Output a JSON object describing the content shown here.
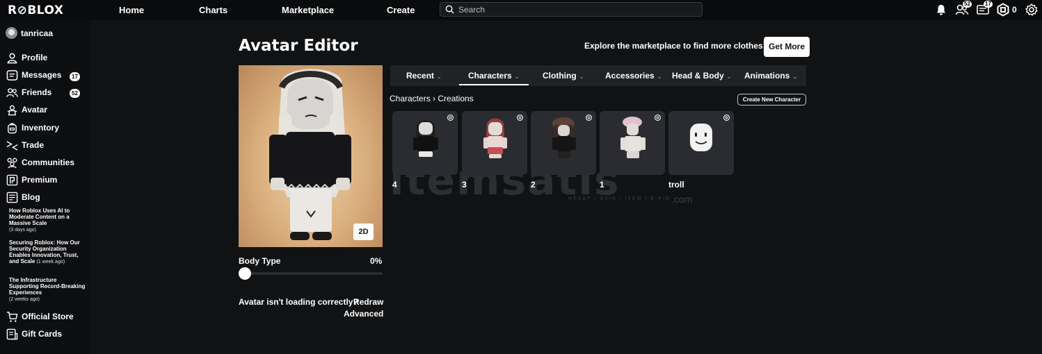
{
  "topbar": {
    "logo": "R⊘BLOX",
    "nav": [
      "Home",
      "Charts",
      "Marketplace",
      "Create"
    ],
    "search_placeholder": "Search",
    "friends_badge": "52",
    "messages_badge": "17",
    "robux": "0"
  },
  "sidebar": {
    "username": "tanricaa",
    "items": [
      {
        "label": "Profile",
        "icon": "person-icon"
      },
      {
        "label": "Messages",
        "icon": "messages-icon",
        "badge": "17"
      },
      {
        "label": "Friends",
        "icon": "friends-icon",
        "badge": "52"
      },
      {
        "label": "Avatar",
        "icon": "avatar-icon"
      },
      {
        "label": "Inventory",
        "icon": "inventory-icon"
      },
      {
        "label": "Trade",
        "icon": "trade-icon"
      },
      {
        "label": "Communities",
        "icon": "communities-icon"
      },
      {
        "label": "Premium",
        "icon": "premium-icon"
      },
      {
        "label": "Blog",
        "icon": "blog-icon"
      }
    ],
    "blog_posts": [
      {
        "title": "How Roblox Uses AI to Moderate Content on a Massive Scale",
        "ago": "(3 days ago)"
      },
      {
        "title": "Securing Roblox: How Our Security Organization Enables Innovation, Trust, and Scale",
        "ago": "(1 week ago)"
      },
      {
        "title": "The Infrastructure Supporting Record-Breaking Experiences",
        "ago": "(2 weeks ago)"
      }
    ],
    "bottom_items": [
      {
        "label": "Official Store",
        "icon": "cart-icon"
      },
      {
        "label": "Gift Cards",
        "icon": "gift-card-icon"
      }
    ]
  },
  "main": {
    "title": "Avatar Editor",
    "explore_text": "Explore the marketplace to find more clothes!",
    "get_more": "Get More",
    "view_toggle": "2D",
    "body_type_label": "Body Type",
    "body_type_value": "0%",
    "body_type_fraction": 0,
    "not_loading": "Avatar isn't loading correctly?",
    "redraw": "Redraw",
    "advanced": "Advanced",
    "tabs": [
      "Recent",
      "Characters",
      "Clothing",
      "Accessories",
      "Head & Body",
      "Animations"
    ],
    "active_tab": "Characters",
    "breadcrumb": "Characters › Creations",
    "create_new": "Create New Character",
    "characters": [
      "4",
      "3",
      "2",
      "1",
      "troll"
    ]
  },
  "watermark": {
    "text": "itemsatis",
    "sub": "HESAP / SKIN / ITEM / E-PIN",
    "com": ".com"
  }
}
